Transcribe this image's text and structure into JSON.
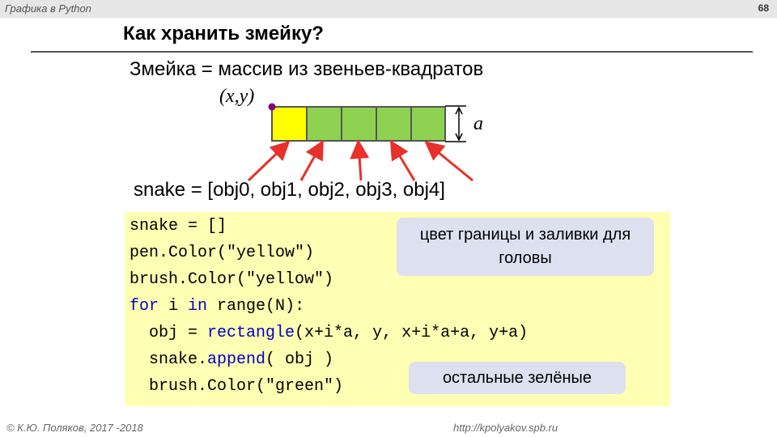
{
  "header": {
    "course": "Графика в Python",
    "page_number": "68"
  },
  "title": "Как хранить змейку?",
  "subtitle": "Змейка = массив из звеньев-квадратов",
  "diagram": {
    "origin_label": "(x,y)",
    "size_label": "a",
    "list_line": "snake = [obj0, obj1, obj2, obj3, obj4]",
    "colors": {
      "head": "#ffff00",
      "body": "#8fd150",
      "origin_dot": "#800080",
      "arrow": "#e8312a"
    }
  },
  "code": {
    "line1": "snake = []",
    "line2": "pen.Color(\"yellow\")",
    "line3": "brush.Color(\"yellow\")",
    "line4_kw1": "for",
    "line4_mid": " i ",
    "line4_kw2": "in",
    "line4_rest": " range(N):",
    "line5_a": "  obj = ",
    "line5_kw": "rectangle",
    "line5_b": "(x+i*a, y, x+i*a+a, y+a)",
    "line6_a": "  snake.",
    "line6_kw": "append",
    "line6_b": "( obj )",
    "line7": "  brush.Color(\"green\")"
  },
  "callouts": {
    "head_color": "цвет границы и заливки для головы",
    "rest_green": "остальные зелёные"
  },
  "footer": {
    "author": "© К.Ю. Поляков, 2017 -2018",
    "url": "http://kpolyakov.spb.ru"
  }
}
